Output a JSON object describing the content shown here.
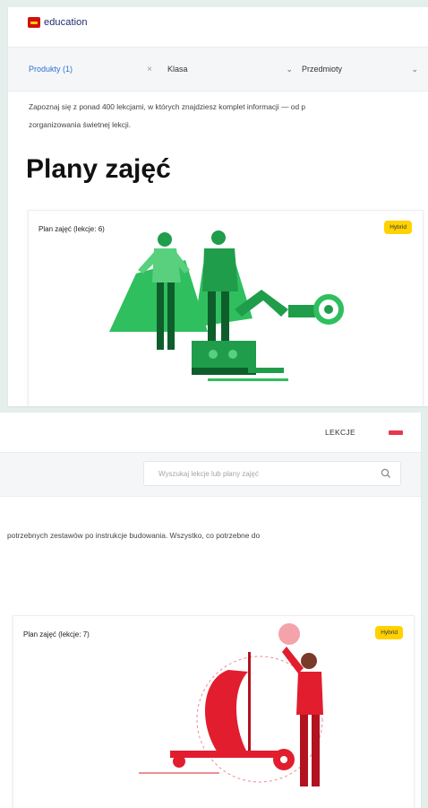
{
  "logo": {
    "text": "education"
  },
  "filters": {
    "products_label": "Produkty (1)",
    "products_clear": "×",
    "class_label": "Klasa",
    "subjects_label": "Przedmioty",
    "chevron": "⌄"
  },
  "nav": {
    "lessons": "LEKCJE"
  },
  "search": {
    "placeholder": "Wyszukaj lekcje lub plany zajęć"
  },
  "intro": {
    "line1_left": "Zapoznaj się z ponad 400 lekcjami, w których znajdziesz komplet informacji — od p",
    "line1_right": "potrzebnych zestawów po instrukcje budowania. Wszystko, co potrzebne do",
    "line2": "zorganizowania świetnej lekcji."
  },
  "page_title": "Plany zajęć",
  "cards": [
    {
      "title": "Plan zajęć (lekcje: 6)",
      "badge": "Hybrid"
    },
    {
      "title": "Plan zajęć (lekcje: 7)",
      "badge": "Hybrid"
    }
  ],
  "colors": {
    "background": "#e4efec",
    "accent_blue": "#2b74d9",
    "badge_yellow": "#ffd200",
    "illustration_green": "#1f9d4a",
    "illustration_red": "#e11d2e",
    "brand_red": "#d01012"
  },
  "icons": {
    "logo": "lego-logo-icon",
    "search": "search-icon",
    "flag": "language-flag-icon",
    "chevron": "chevron-down-icon",
    "clear": "close-icon"
  }
}
